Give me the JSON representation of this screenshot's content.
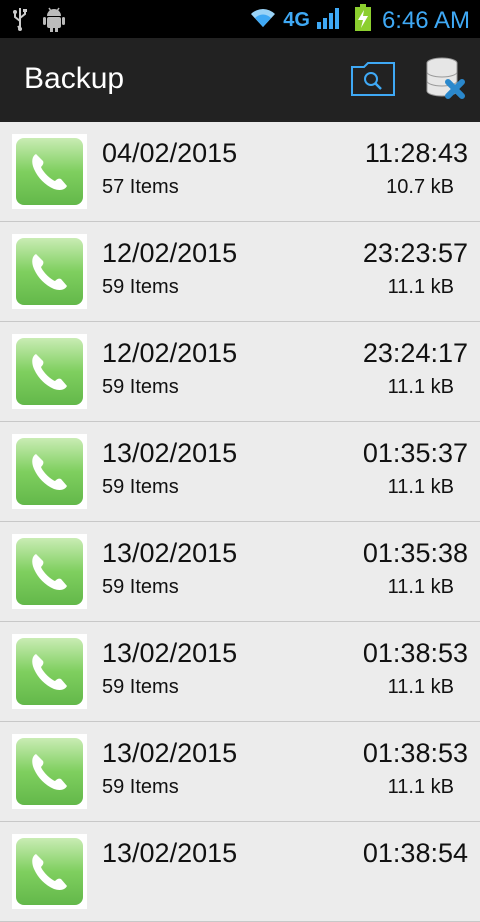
{
  "status_bar": {
    "left_icons": [
      "usb-icon",
      "android-debug-icon"
    ],
    "right_icons": [
      "wifi-icon",
      "signal-icon",
      "battery-charging-icon"
    ],
    "network": "4G",
    "time": "6:46 AM",
    "accent_color": "#3fa9f5"
  },
  "action_bar": {
    "title": "Backup",
    "actions": [
      {
        "name": "browse-folder-icon"
      },
      {
        "name": "delete-database-icon"
      }
    ]
  },
  "backups": [
    {
      "date": "04/02/2015",
      "items": "57 Items",
      "time": "11:28:43",
      "size": "10.7 kB"
    },
    {
      "date": "12/02/2015",
      "items": "59 Items",
      "time": "23:23:57",
      "size": "11.1 kB"
    },
    {
      "date": "12/02/2015",
      "items": "59 Items",
      "time": "23:24:17",
      "size": "11.1 kB"
    },
    {
      "date": "13/02/2015",
      "items": "59 Items",
      "time": "01:35:37",
      "size": "11.1 kB"
    },
    {
      "date": "13/02/2015",
      "items": "59 Items",
      "time": "01:35:38",
      "size": "11.1 kB"
    },
    {
      "date": "13/02/2015",
      "items": "59 Items",
      "time": "01:38:53",
      "size": "11.1 kB"
    },
    {
      "date": "13/02/2015",
      "items": "59 Items",
      "time": "01:38:53",
      "size": "11.1 kB"
    },
    {
      "date": "13/02/2015",
      "items": "",
      "time": "01:38:54",
      "size": ""
    }
  ]
}
